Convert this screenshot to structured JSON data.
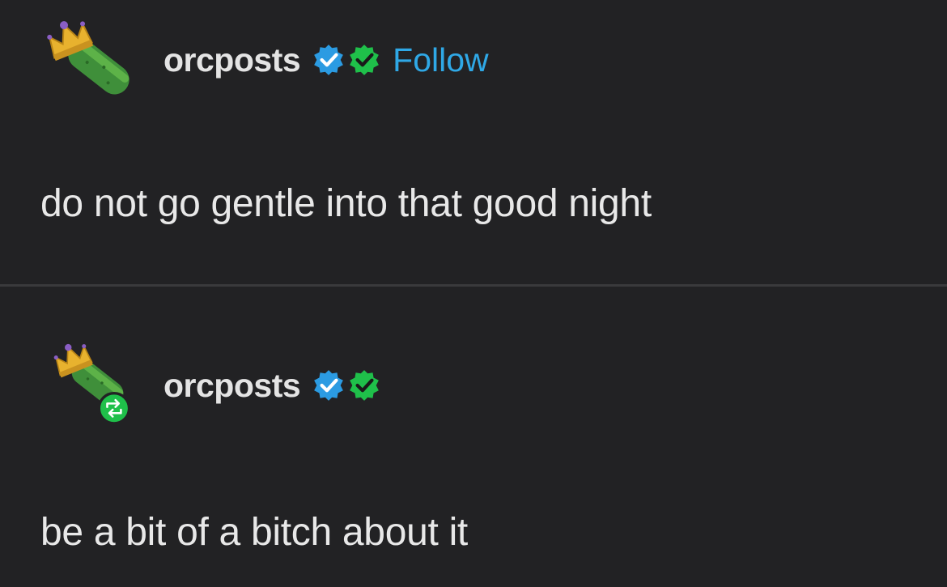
{
  "posts": [
    {
      "username": "orcposts",
      "follow_label": "Follow",
      "text": "do not go gentle into that good night",
      "avatar_icon": "crowned-cucumber-icon",
      "badges": [
        "blue-verified-badge-icon",
        "green-verified-badge-icon"
      ]
    },
    {
      "username": "orcposts",
      "text": "be a bit of a bitch about it",
      "avatar_icon": "crowned-cucumber-icon",
      "reblog_icon": "reblog-icon",
      "badges": [
        "blue-verified-badge-icon",
        "green-verified-badge-icon"
      ]
    }
  ],
  "colors": {
    "background": "#222224",
    "follow": "#2fa8e6",
    "blue_badge": "#2b9be2",
    "green_badge": "#1fc04a",
    "divider": "#3a3a3c"
  }
}
